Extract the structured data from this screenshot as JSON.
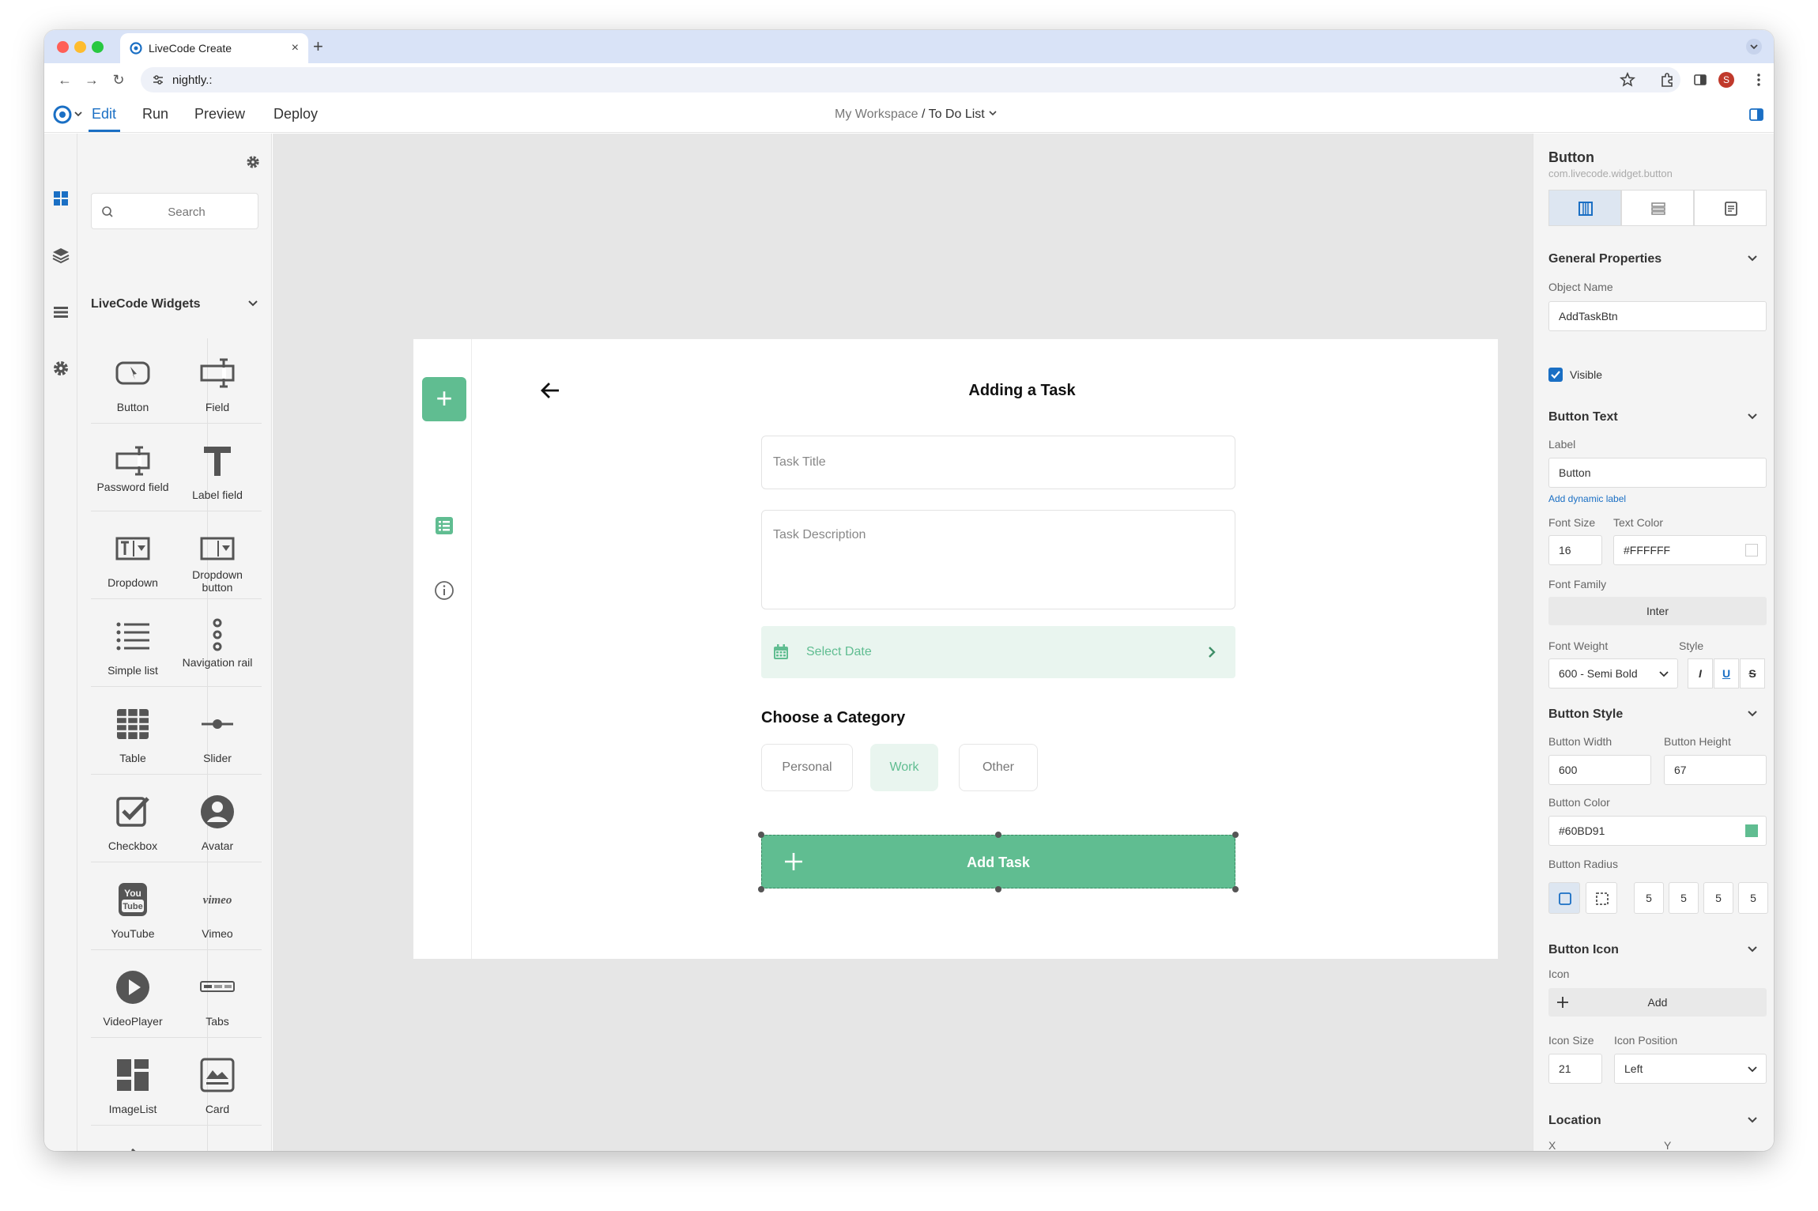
{
  "browser": {
    "tab_title": "LiveCode Create",
    "tab_close": "×",
    "new_tab": "+",
    "url": "nightly.:",
    "profile_initial": "S"
  },
  "toolbar": {
    "menu": [
      "Edit",
      "Run",
      "Preview",
      "Deploy"
    ],
    "workspace": "My Workspace",
    "separator": "/",
    "project": "To Do List"
  },
  "widgets": {
    "search_placeholder": "Search",
    "section_title": "LiveCode Widgets",
    "items": [
      {
        "label": "Button",
        "icon": "button-icon"
      },
      {
        "label": "Field",
        "icon": "field-icon"
      },
      {
        "label": "Password field",
        "icon": "password-field-icon"
      },
      {
        "label": "Label field",
        "icon": "label-field-icon"
      },
      {
        "label": "Dropdown",
        "icon": "dropdown-icon"
      },
      {
        "label": "Dropdown button",
        "icon": "dropdown-button-icon"
      },
      {
        "label": "Simple list",
        "icon": "simple-list-icon"
      },
      {
        "label": "Navigation rail",
        "icon": "navigation-rail-icon"
      },
      {
        "label": "Table",
        "icon": "table-icon"
      },
      {
        "label": "Slider",
        "icon": "slider-icon"
      },
      {
        "label": "Checkbox",
        "icon": "checkbox-icon"
      },
      {
        "label": "Avatar",
        "icon": "avatar-icon"
      },
      {
        "label": "YouTube",
        "icon": "youtube-icon"
      },
      {
        "label": "Vimeo",
        "icon": "vimeo-icon"
      },
      {
        "label": "VideoPlayer",
        "icon": "video-player-icon"
      },
      {
        "label": "Tabs",
        "icon": "tabs-icon"
      },
      {
        "label": "ImageList",
        "icon": "image-list-icon"
      },
      {
        "label": "Card",
        "icon": "card-icon"
      },
      {
        "label": "",
        "icon": "tag-icon"
      },
      {
        "label": "",
        "icon": "rating-icon"
      }
    ]
  },
  "canvas": {
    "title": "Adding a Task",
    "task_title_placeholder": "Task Title",
    "task_description_placeholder": "Task Description",
    "select_date": "Select Date",
    "category_title": "Choose a Category",
    "categories": [
      {
        "label": "Personal",
        "active": false
      },
      {
        "label": "Work",
        "active": true
      },
      {
        "label": "Other",
        "active": false
      }
    ],
    "add_task": "Add Task",
    "fab": "+"
  },
  "inspector": {
    "title": "Button",
    "subtitle": "com.livecode.widget.button",
    "general": {
      "section": "General Properties",
      "object_name_label": "Object Name",
      "object_name": "AddTaskBtn",
      "visible_label": "Visible",
      "visible": true
    },
    "text": {
      "section": "Button Text",
      "label_label": "Label",
      "label": "Button",
      "add_dynamic": "Add dynamic label",
      "font_size_label": "Font Size",
      "font_size": "16",
      "text_color_label": "Text Color",
      "text_color": "#FFFFFF",
      "font_family_label": "Font Family",
      "font_family": "Inter",
      "font_weight_label": "Font Weight",
      "font_weight": "600 - Semi Bold",
      "style_label": "Style",
      "style_buttons": [
        "I",
        "U",
        "S"
      ]
    },
    "style": {
      "section": "Button Style",
      "width_label": "Button Width",
      "width": "600",
      "height_label": "Button Height",
      "height": "67",
      "color_label": "Button Color",
      "color": "#60BD91",
      "radius_label": "Button Radius",
      "radius": [
        "5",
        "5",
        "5",
        "5"
      ]
    },
    "icon": {
      "section": "Button Icon",
      "icon_label": "Icon",
      "add": "Add",
      "size_label": "Icon Size",
      "size": "21",
      "position_label": "Icon Position",
      "position": "Left"
    },
    "location": {
      "section": "Location",
      "x_label": "X",
      "y_label": "Y"
    }
  },
  "colors": {
    "accent": "#60BD91",
    "link": "#1A6FC4"
  }
}
